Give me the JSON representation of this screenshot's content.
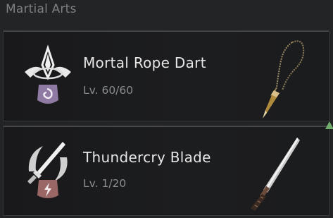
{
  "section": {
    "title": "Martial Arts"
  },
  "weapons": [
    {
      "name": "Mortal Rope Dart",
      "level": "Lv. 60/60",
      "emblem_icon": "rope-dart-emblem-icon",
      "badge_icon": "spiral-badge-icon",
      "art_icon": "rope-dart-weapon-icon"
    },
    {
      "name": "Thundercry Blade",
      "level": "Lv. 1/20",
      "emblem_icon": "blade-emblem-icon",
      "badge_icon": "lightning-badge-icon",
      "art_icon": "blade-weapon-icon"
    }
  ],
  "colors": {
    "background": "#232426",
    "card": "#1b1c1e",
    "name_text": "#e6e6e6",
    "level_text": "#8a8c90",
    "accent_green": "#6fae6d",
    "badge_purple": "#8f7aa3",
    "badge_red": "#9a6766"
  }
}
